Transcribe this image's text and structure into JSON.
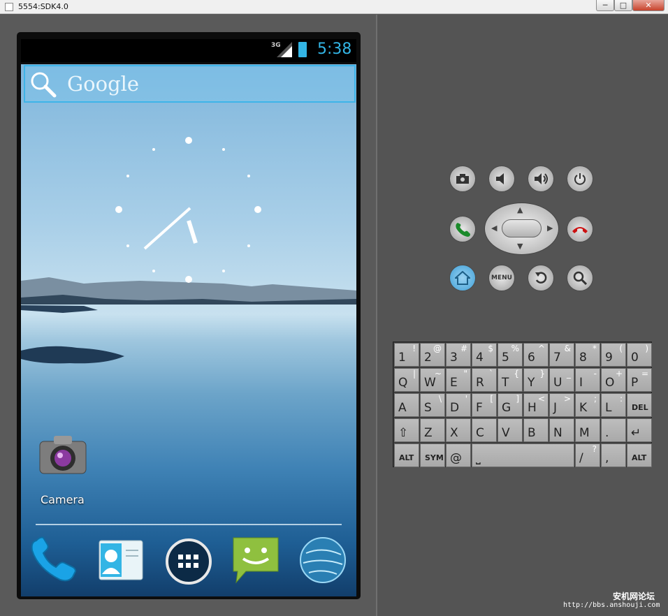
{
  "window": {
    "title": "5554:SDK4.0",
    "minimize": "─",
    "maximize": "□",
    "close": "✕"
  },
  "status_bar": {
    "network": "3G",
    "time": "5:38"
  },
  "search_widget": {
    "text": "Google"
  },
  "home": {
    "app_icon_label": "Camera"
  },
  "dock": {
    "items": [
      "phone-icon",
      "contacts-icon",
      "all-apps-icon",
      "messaging-icon",
      "browser-icon"
    ]
  },
  "controls": {
    "menu_label": "MENU"
  },
  "keyboard": {
    "rows": [
      [
        [
          "1",
          "!"
        ],
        [
          "2",
          "@"
        ],
        [
          "3",
          "#"
        ],
        [
          "4",
          "$"
        ],
        [
          "5",
          "%"
        ],
        [
          "6",
          "^"
        ],
        [
          "7",
          "&"
        ],
        [
          "8",
          "*"
        ],
        [
          "9",
          "("
        ],
        [
          "0",
          ")"
        ]
      ],
      [
        [
          "Q",
          "|"
        ],
        [
          "W",
          "~"
        ],
        [
          "E",
          "\""
        ],
        [
          "R",
          "`"
        ],
        [
          "T",
          "{"
        ],
        [
          "Y",
          "}"
        ],
        [
          "U",
          "_"
        ],
        [
          "I",
          "-"
        ],
        [
          "O",
          "+"
        ],
        [
          "P",
          "="
        ]
      ],
      [
        [
          "A",
          ""
        ],
        [
          "S",
          "\\"
        ],
        [
          "D",
          "'"
        ],
        [
          "F",
          "["
        ],
        [
          "G",
          "]"
        ],
        [
          "H",
          "<"
        ],
        [
          "J",
          ">"
        ],
        [
          "K",
          ";"
        ],
        [
          "L",
          ":"
        ],
        [
          "DEL",
          ""
        ]
      ],
      [
        [
          "⇧",
          ""
        ],
        [
          "Z",
          ""
        ],
        [
          "X",
          ""
        ],
        [
          "C",
          ""
        ],
        [
          "V",
          ""
        ],
        [
          "B",
          ""
        ],
        [
          "N",
          ""
        ],
        [
          "M",
          ""
        ],
        [
          ".",
          ""
        ],
        [
          "↵",
          ""
        ]
      ],
      [
        [
          "ALT",
          ""
        ],
        [
          "SYM",
          ""
        ],
        [
          "@",
          ""
        ],
        [
          "⎵",
          ""
        ],
        [
          "/",
          "?"
        ],
        [
          ",",
          ""
        ],
        [
          "ALT",
          ""
        ]
      ]
    ]
  },
  "watermark": {
    "line1": "安机网论坛",
    "line2": "http://bbs.anshouji.com"
  }
}
